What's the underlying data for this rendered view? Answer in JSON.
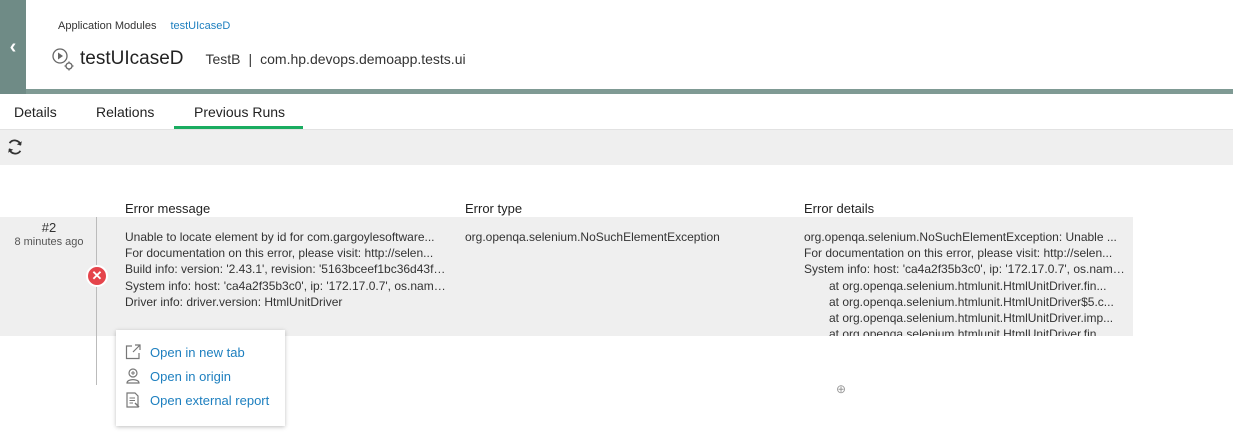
{
  "header": {
    "breadcrumb": [
      "Application Modules",
      "testUIcaseD"
    ],
    "title": "testUIcaseD",
    "class_name": "TestB",
    "separator": "|",
    "package": "com.hp.devops.demoapp.tests.ui",
    "back_icon": "chevron-left-icon"
  },
  "tabs": [
    {
      "label": "Details",
      "active": false
    },
    {
      "label": "Relations",
      "active": false
    },
    {
      "label": "Previous Runs",
      "active": true
    }
  ],
  "toolbar": {
    "refresh_icon": "refresh-icon"
  },
  "columns": {
    "error_message": "Error message",
    "error_type": "Error type",
    "error_details": "Error details"
  },
  "runs": [
    {
      "number": "#2",
      "time": "8 minutes ago",
      "status": "failed",
      "error_message_lines": [
        "Unable to locate element by id for com.gargoylesoftware...",
        "For documentation on this error, please visit: http://selen...",
        "Build info: version: '2.43.1', revision: '5163bceef1bc36d43f3...",
        "System info: host: 'ca4a2f35b3c0', ip: '172.17.0.7', os.name:...",
        "Driver info: driver.version: HtmlUnitDriver"
      ],
      "error_type": "org.openqa.selenium.NoSuchElementException",
      "error_details_lines": [
        "org.openqa.selenium.NoSuchElementException: Unable ...",
        "For documentation on this error, please visit: http://selen...",
        "System info: host: 'ca4a2f35b3c0', ip: '172.17.0.7', os.name:...",
        "at org.openqa.selenium.htmlunit.HtmlUnitDriver.fin...",
        "at org.openqa.selenium.htmlunit.HtmlUnitDriver$5.c...",
        "at org.openqa.selenium.htmlunit.HtmlUnitDriver.imp...",
        "at org.openqa.selenium.htmlunit.HtmlUnitDriver.fin..."
      ]
    }
  ],
  "context_menu": [
    {
      "label": "Open in new tab",
      "icon": "external-link-icon"
    },
    {
      "label": "Open in origin",
      "icon": "origin-icon"
    },
    {
      "label": "Open external report",
      "icon": "report-icon"
    }
  ],
  "colors": {
    "accent": "#1aac60",
    "header_band": "#6f8b86",
    "link": "#1d7fbf",
    "fail": "#e5444b"
  }
}
